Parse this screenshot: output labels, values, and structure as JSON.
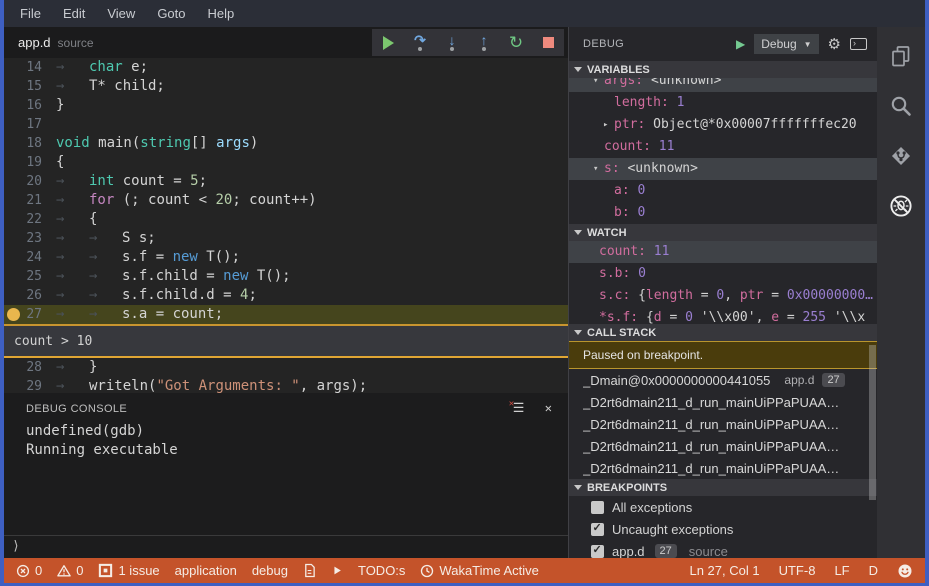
{
  "window": {
    "border_color": "#3e5fc2"
  },
  "menu_bar": {
    "items": [
      "File",
      "Edit",
      "View",
      "Goto",
      "Help"
    ]
  },
  "tab_bar": {
    "active_tab": {
      "name": "app.d",
      "hint": "source"
    }
  },
  "debug_toolbar": {
    "buttons": [
      {
        "name": "continue-button",
        "icon": "play",
        "color": "#7cc76f"
      },
      {
        "name": "step-over-button",
        "icon": "step-over",
        "color": "#71a8e0"
      },
      {
        "name": "step-into-button",
        "icon": "step-into",
        "color": "#71a8e0"
      },
      {
        "name": "step-out-button",
        "icon": "step-out",
        "color": "#71a8e0"
      },
      {
        "name": "restart-button",
        "icon": "restart",
        "color": "#6fc783"
      },
      {
        "name": "stop-button",
        "icon": "stop",
        "color": "#ef8a7e"
      }
    ]
  },
  "editor": {
    "breakpoint_line": 27,
    "current_line": 27,
    "condition_widget": {
      "after_line": 27,
      "text": "count > 10"
    },
    "lines": [
      {
        "no": 14,
        "tokens": [
          {
            "t": "→",
            "c": "tab"
          },
          {
            "t": "char",
            "c": "kw"
          },
          {
            "t": " e;",
            "c": "pl"
          }
        ]
      },
      {
        "no": 15,
        "tokens": [
          {
            "t": "→",
            "c": "tab"
          },
          {
            "t": "T* child;",
            "c": "pl"
          }
        ]
      },
      {
        "no": 16,
        "tokens": [
          {
            "t": "}",
            "c": "pl"
          }
        ]
      },
      {
        "no": 17,
        "tokens": []
      },
      {
        "no": 18,
        "tokens": [
          {
            "t": "void",
            "c": "kw"
          },
          {
            "t": " main(",
            "c": "pl"
          },
          {
            "t": "string",
            "c": "kw"
          },
          {
            "t": "[] ",
            "c": "pl"
          },
          {
            "t": "args",
            "c": "arg"
          },
          {
            "t": ")",
            "c": "pl"
          }
        ]
      },
      {
        "no": 19,
        "tokens": [
          {
            "t": "{",
            "c": "pl"
          }
        ]
      },
      {
        "no": 20,
        "tokens": [
          {
            "t": "→",
            "c": "tab"
          },
          {
            "t": "int",
            "c": "kw"
          },
          {
            "t": " count = ",
            "c": "pl"
          },
          {
            "t": "5",
            "c": "num"
          },
          {
            "t": ";",
            "c": "pl"
          }
        ]
      },
      {
        "no": 21,
        "tokens": [
          {
            "t": "→",
            "c": "tab"
          },
          {
            "t": "for",
            "c": "ctrl"
          },
          {
            "t": " (; count < ",
            "c": "pl"
          },
          {
            "t": "20",
            "c": "num"
          },
          {
            "t": "; count++)",
            "c": "pl"
          }
        ]
      },
      {
        "no": 22,
        "tokens": [
          {
            "t": "→",
            "c": "tab"
          },
          {
            "t": "{",
            "c": "pl"
          }
        ]
      },
      {
        "no": 23,
        "tokens": [
          {
            "t": "→",
            "c": "tab"
          },
          {
            "t": "→",
            "c": "tab"
          },
          {
            "t": "S s;",
            "c": "pl"
          }
        ]
      },
      {
        "no": 24,
        "tokens": [
          {
            "t": "→",
            "c": "tab"
          },
          {
            "t": "→",
            "c": "tab"
          },
          {
            "t": "s.f = ",
            "c": "pl"
          },
          {
            "t": "new",
            "c": "new"
          },
          {
            "t": " T();",
            "c": "pl"
          }
        ]
      },
      {
        "no": 25,
        "tokens": [
          {
            "t": "→",
            "c": "tab"
          },
          {
            "t": "→",
            "c": "tab"
          },
          {
            "t": "s.f.child = ",
            "c": "pl"
          },
          {
            "t": "new",
            "c": "new"
          },
          {
            "t": " T();",
            "c": "pl"
          }
        ]
      },
      {
        "no": 26,
        "tokens": [
          {
            "t": "→",
            "c": "tab"
          },
          {
            "t": "→",
            "c": "tab"
          },
          {
            "t": "s.f.child.d = ",
            "c": "pl"
          },
          {
            "t": "4",
            "c": "num"
          },
          {
            "t": ";",
            "c": "pl"
          }
        ]
      },
      {
        "no": 27,
        "tokens": [
          {
            "t": "→",
            "c": "tab"
          },
          {
            "t": "→",
            "c": "tab"
          },
          {
            "t": "s.a = count;",
            "c": "pl"
          }
        ]
      },
      {
        "no": 28,
        "tokens": [
          {
            "t": "→",
            "c": "tab"
          },
          {
            "t": "}",
            "c": "pl"
          }
        ]
      },
      {
        "no": 29,
        "tokens": [
          {
            "t": "→",
            "c": "tab"
          },
          {
            "t": "writeln(",
            "c": "pl"
          },
          {
            "t": "\"Got Arguments: \"",
            "c": "str"
          },
          {
            "t": ", args);",
            "c": "pl"
          }
        ]
      }
    ]
  },
  "debug_console": {
    "title": "DEBUG CONSOLE",
    "output": [
      "undefined(gdb)",
      "Running executable"
    ],
    "prompt": "⟩",
    "icons": [
      "clear-console-icon",
      "close-icon"
    ]
  },
  "debug_panel": {
    "title": "DEBUG",
    "config_dropdown": {
      "label": "Debug"
    },
    "header_icons": [
      "start-debug-icon",
      "gear-icon",
      "open-console-icon"
    ],
    "variables": {
      "title": "VARIABLES",
      "rows": [
        {
          "name": "args:",
          "value_tokens": [
            {
              "t": "<unknown>",
              "c": "pl"
            }
          ],
          "expander": "open",
          "level": "root",
          "highlight": true,
          "clipped": true
        },
        {
          "name": "length:",
          "value_tokens": [
            {
              "t": "1",
              "c": "num"
            }
          ],
          "level": "child"
        },
        {
          "name": "ptr:",
          "value_tokens": [
            {
              "t": "Object@*0x00007fffffffec20",
              "c": "pl"
            }
          ],
          "level": "child",
          "expander": "closed"
        },
        {
          "name": "count:",
          "value_tokens": [
            {
              "t": "11",
              "c": "num"
            }
          ],
          "level": "root"
        },
        {
          "name": "s:",
          "value_tokens": [
            {
              "t": "<unknown>",
              "c": "pl"
            }
          ],
          "expander": "open",
          "level": "root",
          "highlight": true
        },
        {
          "name": "a:",
          "value_tokens": [
            {
              "t": "0",
              "c": "num"
            }
          ],
          "level": "child"
        },
        {
          "name": "b:",
          "value_tokens": [
            {
              "t": "0",
              "c": "num"
            }
          ],
          "level": "child"
        }
      ]
    },
    "watch": {
      "title": "WATCH",
      "rows": [
        {
          "name": "count:",
          "value_tokens": [
            {
              "t": "11",
              "c": "num"
            }
          ],
          "highlight": true
        },
        {
          "name": "s.b:",
          "value_tokens": [
            {
              "t": "0",
              "c": "num"
            }
          ]
        },
        {
          "name": "s.c:",
          "value_tokens": [
            {
              "t": "{",
              "c": "pl"
            },
            {
              "t": "length",
              "c": "name"
            },
            {
              "t": " = ",
              "c": "pl"
            },
            {
              "t": "0",
              "c": "num"
            },
            {
              "t": ", ",
              "c": "pl"
            },
            {
              "t": "ptr",
              "c": "name"
            },
            {
              "t": " = ",
              "c": "pl"
            },
            {
              "t": "0x00000000…",
              "c": "num"
            }
          ]
        },
        {
          "name": "*s.f:",
          "value_tokens": [
            {
              "t": "{",
              "c": "pl"
            },
            {
              "t": "d",
              "c": "name"
            },
            {
              "t": " = ",
              "c": "pl"
            },
            {
              "t": "0",
              "c": "num"
            },
            {
              "t": " '\\\\x00'",
              "c": "pl"
            },
            {
              "t": ", ",
              "c": "pl"
            },
            {
              "t": "e",
              "c": "name"
            },
            {
              "t": " = ",
              "c": "pl"
            },
            {
              "t": "255",
              "c": "num"
            },
            {
              "t": " '\\\\x",
              "c": "pl"
            }
          ],
          "clipped2": true
        }
      ]
    },
    "call_stack": {
      "title": "CALL STACK",
      "message": "Paused on breakpoint.",
      "frames": [
        {
          "name": "_Dmain@0x0000000000441055",
          "file": "app.d",
          "line_badge": "27"
        },
        {
          "name": "_D2rt6dmain211_d_run_mainUiPPaPUAA…"
        },
        {
          "name": "_D2rt6dmain211_d_run_mainUiPPaPUAA…"
        },
        {
          "name": "_D2rt6dmain211_d_run_mainUiPPaPUAA…"
        },
        {
          "name": "_D2rt6dmain211_d_run_mainUiPPaPUAA…"
        }
      ]
    },
    "breakpoints": {
      "title": "BREAKPOINTS",
      "items": [
        {
          "label": "All exceptions",
          "checked": false
        },
        {
          "label": "Uncaught exceptions",
          "checked": true
        },
        {
          "label": "app.d",
          "badge": "27",
          "hint": "source",
          "checked": true
        }
      ]
    }
  },
  "activity_bar": {
    "icons": [
      {
        "name": "files-icon"
      },
      {
        "name": "search-icon"
      },
      {
        "name": "source-control-icon"
      },
      {
        "name": "debug-icon",
        "active": true
      }
    ]
  },
  "status_bar": {
    "background": "#c4532a",
    "left": [
      {
        "icon": "error-icon",
        "text": "0"
      },
      {
        "icon": "warning-icon",
        "text": "0"
      },
      {
        "icon": "issues-icon",
        "text": "1 issue"
      },
      {
        "text": "application"
      },
      {
        "text": "debug"
      },
      {
        "icon": "file-icon"
      },
      {
        "icon": "play-icon"
      },
      {
        "text": "TODO:s"
      },
      {
        "icon": "clock-icon",
        "text": "WakaTime Active"
      }
    ],
    "right": [
      {
        "text": "Ln 27, Col 1"
      },
      {
        "text": "UTF-8"
      },
      {
        "text": "LF"
      },
      {
        "text": "D"
      },
      {
        "icon": "smiley-icon"
      }
    ]
  }
}
